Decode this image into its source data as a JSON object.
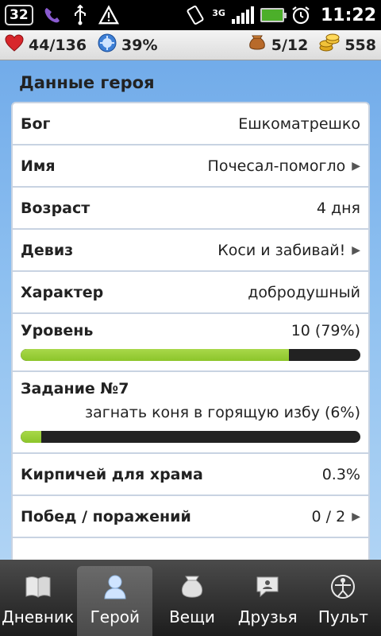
{
  "status_bar": {
    "notification_count": "32",
    "time": "11:22",
    "network_type": "3G",
    "icons": [
      "viber-icon",
      "usb-icon",
      "warning-icon",
      "rotate-icon",
      "signal-icon",
      "battery-icon",
      "alarm-icon"
    ]
  },
  "stats": {
    "health": "44/136",
    "godpower": "39%",
    "inventory": "5/12",
    "gold": "558",
    "colors": {
      "heart": "#d8262b",
      "gold": "#e0a91e"
    }
  },
  "section_title": "Данные героя",
  "rows": [
    {
      "label": "Бог",
      "value": "Ешкоматрешко",
      "arrow": false
    },
    {
      "label": "Имя",
      "value": "Почесал-помогло",
      "arrow": true
    },
    {
      "label": "Возраст",
      "value": "4 дня",
      "arrow": false
    },
    {
      "label": "Девиз",
      "value": "Коси и забивай!",
      "arrow": true
    },
    {
      "label": "Характер",
      "value": "добродушный",
      "arrow": false
    }
  ],
  "level": {
    "label": "Уровень",
    "value": "10 (79%)",
    "progress": 0.79
  },
  "quest": {
    "label": "Задание №7",
    "description": "загнать коня в горящую избу (6%)",
    "progress": 0.06
  },
  "rows_after": [
    {
      "label": "Кирпичей для храма",
      "value": "0.3%",
      "arrow": false
    },
    {
      "label": "Побед / поражений",
      "value": "0 / 2",
      "arrow": true
    }
  ],
  "tabs": [
    {
      "label": "Дневник",
      "icon": "book-icon",
      "active": false
    },
    {
      "label": "Герой",
      "icon": "hero-icon",
      "active": true
    },
    {
      "label": "Вещи",
      "icon": "bag-icon",
      "active": false
    },
    {
      "label": "Друзья",
      "icon": "chat-icon",
      "active": false
    },
    {
      "label": "Пульт",
      "icon": "vitruvian-icon",
      "active": false
    }
  ],
  "colors": {
    "progress_fill": "#8cc52a",
    "progress_track": "#222222",
    "accent_bg": "#8ec0f0"
  }
}
